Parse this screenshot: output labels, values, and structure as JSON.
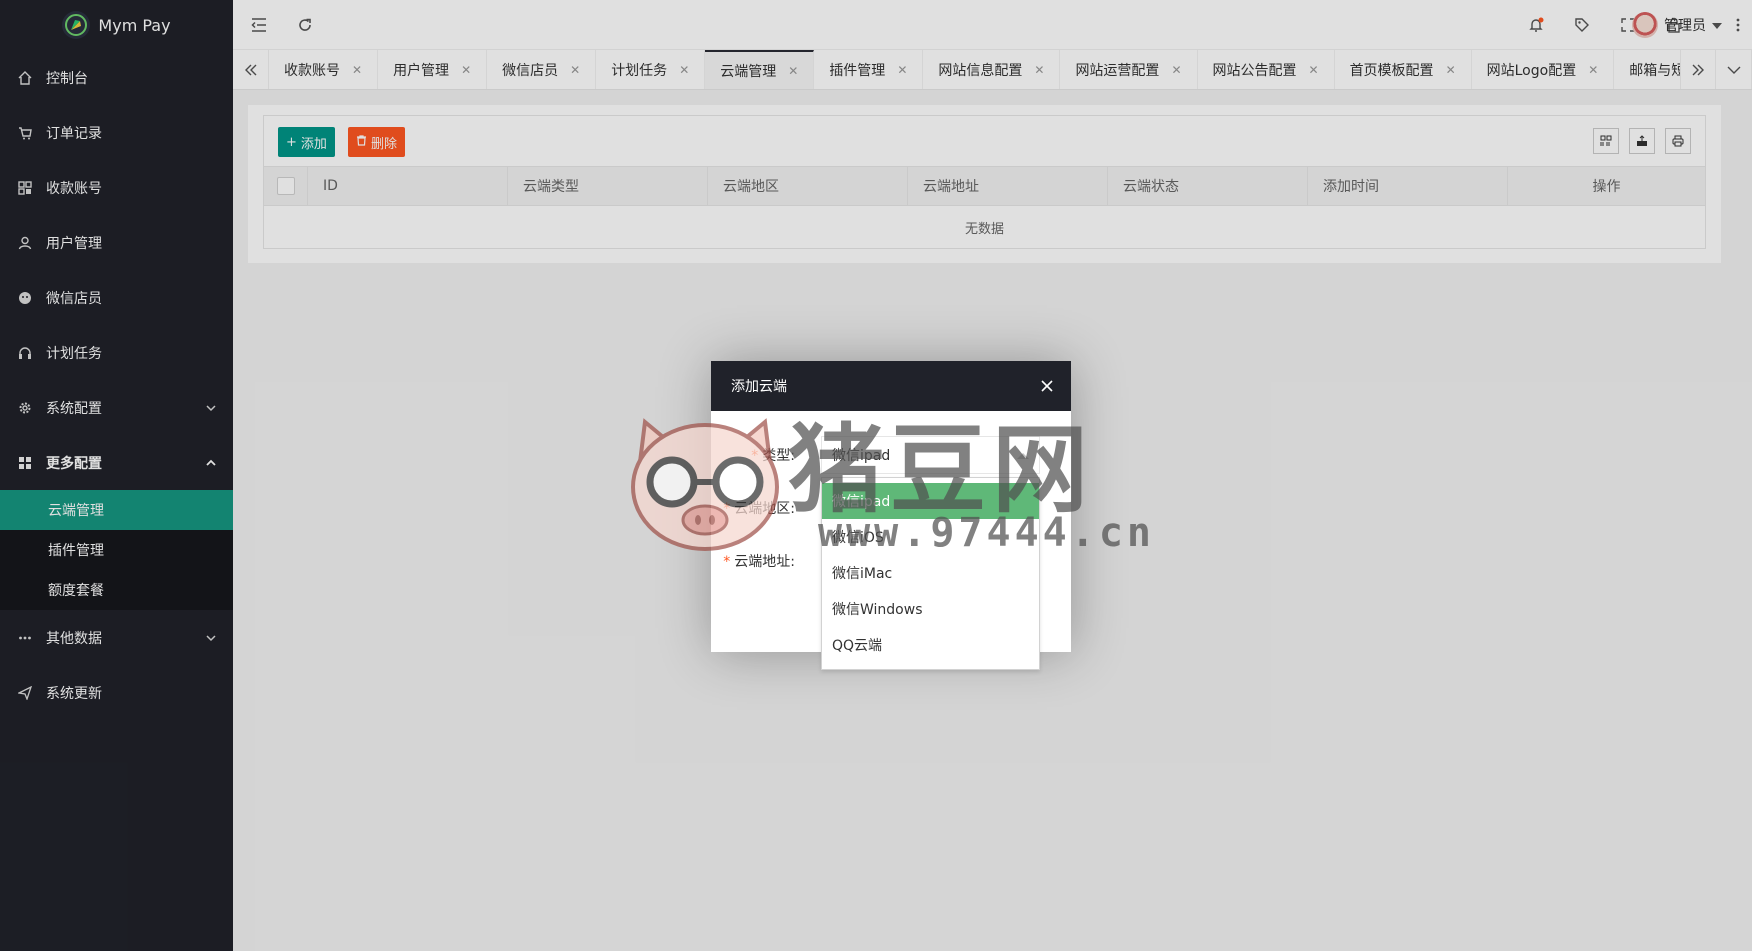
{
  "app": {
    "title": "Mym Pay"
  },
  "sidebar": {
    "items": [
      {
        "label": "控制台",
        "icon": "home-icon"
      },
      {
        "label": "订单记录",
        "icon": "cart-icon"
      },
      {
        "label": "收款账号",
        "icon": "apps-icon"
      },
      {
        "label": "用户管理",
        "icon": "user-icon"
      },
      {
        "label": "微信店员",
        "icon": "wechat-icon"
      },
      {
        "label": "计划任务",
        "icon": "headset-icon"
      },
      {
        "label": "系统配置",
        "icon": "gear-icon"
      },
      {
        "label": "更多配置",
        "icon": "grid-icon"
      }
    ],
    "sub_items": [
      {
        "label": "云端管理",
        "active": true
      },
      {
        "label": "插件管理",
        "active": false
      },
      {
        "label": "额度套餐",
        "active": false
      }
    ],
    "bottom_items": [
      {
        "label": "其他数据",
        "icon": "more-icon"
      },
      {
        "label": "系统更新",
        "icon": "send-icon"
      }
    ]
  },
  "header": {
    "user_name": "管理员"
  },
  "tabs": [
    {
      "label": "收款账号",
      "active": false
    },
    {
      "label": "用户管理",
      "active": false
    },
    {
      "label": "微信店员",
      "active": false
    },
    {
      "label": "计划任务",
      "active": false
    },
    {
      "label": "云端管理",
      "active": true
    },
    {
      "label": "插件管理",
      "active": false
    },
    {
      "label": "网站信息配置",
      "active": false
    },
    {
      "label": "网站运营配置",
      "active": false
    },
    {
      "label": "网站公告配置",
      "active": false
    },
    {
      "label": "首页模板配置",
      "active": false
    },
    {
      "label": "网站Logo配置",
      "active": false
    },
    {
      "label": "邮箱与短信配置",
      "active": false
    }
  ],
  "toolbar": {
    "add_label": "添加",
    "delete_label": "删除"
  },
  "table": {
    "columns": [
      "ID",
      "云端类型",
      "云端地区",
      "云端地址",
      "云端状态",
      "添加时间",
      "操作"
    ],
    "empty_text": "无数据"
  },
  "modal": {
    "title": "添加云端",
    "fields": [
      {
        "label": "类型:"
      },
      {
        "label": "云端地区:"
      },
      {
        "label": "云端地址:"
      }
    ],
    "select_value": "微信ipad",
    "options": [
      {
        "label": "微信ipad",
        "selected": true
      },
      {
        "label": "微信iOS",
        "selected": false
      },
      {
        "label": "微信iMac",
        "selected": false
      },
      {
        "label": "微信Windows",
        "selected": false
      },
      {
        "label": "QQ云端",
        "selected": false
      }
    ]
  },
  "watermark": {
    "brand": "猪豆网",
    "url": "www.97444.cn"
  },
  "colors": {
    "sidebar_bg": "#20222a",
    "active": "#169781",
    "add": "#009688",
    "delete": "#ff5722",
    "option_selected": "#5FB878"
  }
}
